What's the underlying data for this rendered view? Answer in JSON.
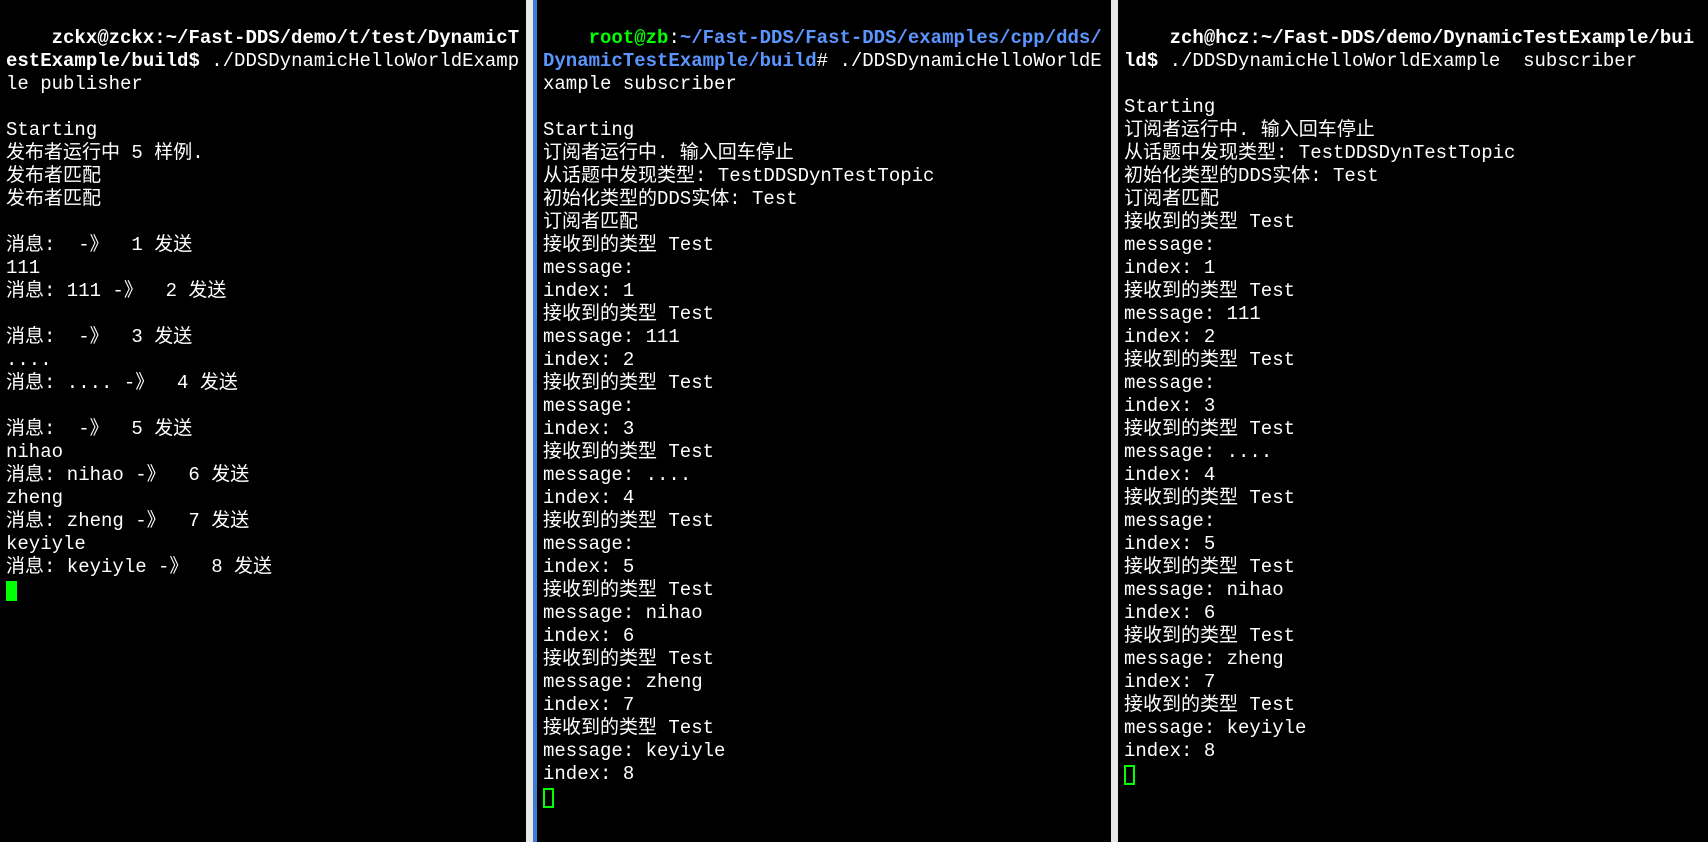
{
  "term1": {
    "prompt_user": "zckx@zckx",
    "prompt_sep1": ":",
    "prompt_path": "~/Fast-DDS/demo/t/test/DynamicTestExample/build",
    "prompt_sep2": "$ ",
    "command": "./DDSDynamicHelloWorldExample publisher",
    "lines": [
      "Starting",
      "发布者运行中 5 样例.",
      "发布者匹配",
      "发布者匹配",
      "",
      "消息:  -》  1 发送",
      "111",
      "消息: 111 -》  2 发送",
      "",
      "消息:  -》  3 发送",
      "....",
      "消息: .... -》  4 发送",
      "",
      "消息:  -》  5 发送",
      "nihao",
      "消息: nihao -》  6 发送",
      "zheng",
      "消息: zheng -》  7 发送",
      "keyiyle",
      "消息: keyiyle -》  8 发送"
    ]
  },
  "term2": {
    "prompt_user": "root@zb",
    "prompt_sep1": ":",
    "prompt_path": "~/Fast-DDS/Fast-DDS/examples/cpp/dds/DynamicTestExample/build",
    "prompt_sep2": "# ",
    "command": "./DDSDynamicHelloWorldExample subscriber",
    "lines": [
      "Starting",
      "订阅者运行中. 输入回车停止",
      "从话题中发现类型: TestDDSDynTestTopic",
      "初始化类型的DDS实体: Test",
      "订阅者匹配",
      "接收到的类型 Test",
      "message:",
      "index: 1",
      "接收到的类型 Test",
      "message: 111",
      "index: 2",
      "接收到的类型 Test",
      "message:",
      "index: 3",
      "接收到的类型 Test",
      "message: ....",
      "index: 4",
      "接收到的类型 Test",
      "message:",
      "index: 5",
      "接收到的类型 Test",
      "message: nihao",
      "index: 6",
      "接收到的类型 Test",
      "message: zheng",
      "index: 7",
      "接收到的类型 Test",
      "message: keyiyle",
      "index: 8"
    ]
  },
  "term3": {
    "prompt_user": "zch@hcz",
    "prompt_sep1": ":",
    "prompt_path": "~/Fast-DDS/demo/DynamicTestExample/build",
    "prompt_sep2": "$ ",
    "command": "./DDSDynamicHelloWorldExample  subscriber",
    "lines": [
      "Starting",
      "订阅者运行中. 输入回车停止",
      "从话题中发现类型: TestDDSDynTestTopic",
      "初始化类型的DDS实体: Test",
      "订阅者匹配",
      "接收到的类型 Test",
      "message:",
      "index: 1",
      "接收到的类型 Test",
      "message: 111",
      "index: 2",
      "接收到的类型 Test",
      "message:",
      "index: 3",
      "接收到的类型 Test",
      "message: ....",
      "index: 4",
      "接收到的类型 Test",
      "message:",
      "index: 5",
      "接收到的类型 Test",
      "message: nihao",
      "index: 6",
      "接收到的类型 Test",
      "message: zheng",
      "index: 7",
      "接收到的类型 Test",
      "message: keyiyle",
      "index: 8"
    ]
  }
}
